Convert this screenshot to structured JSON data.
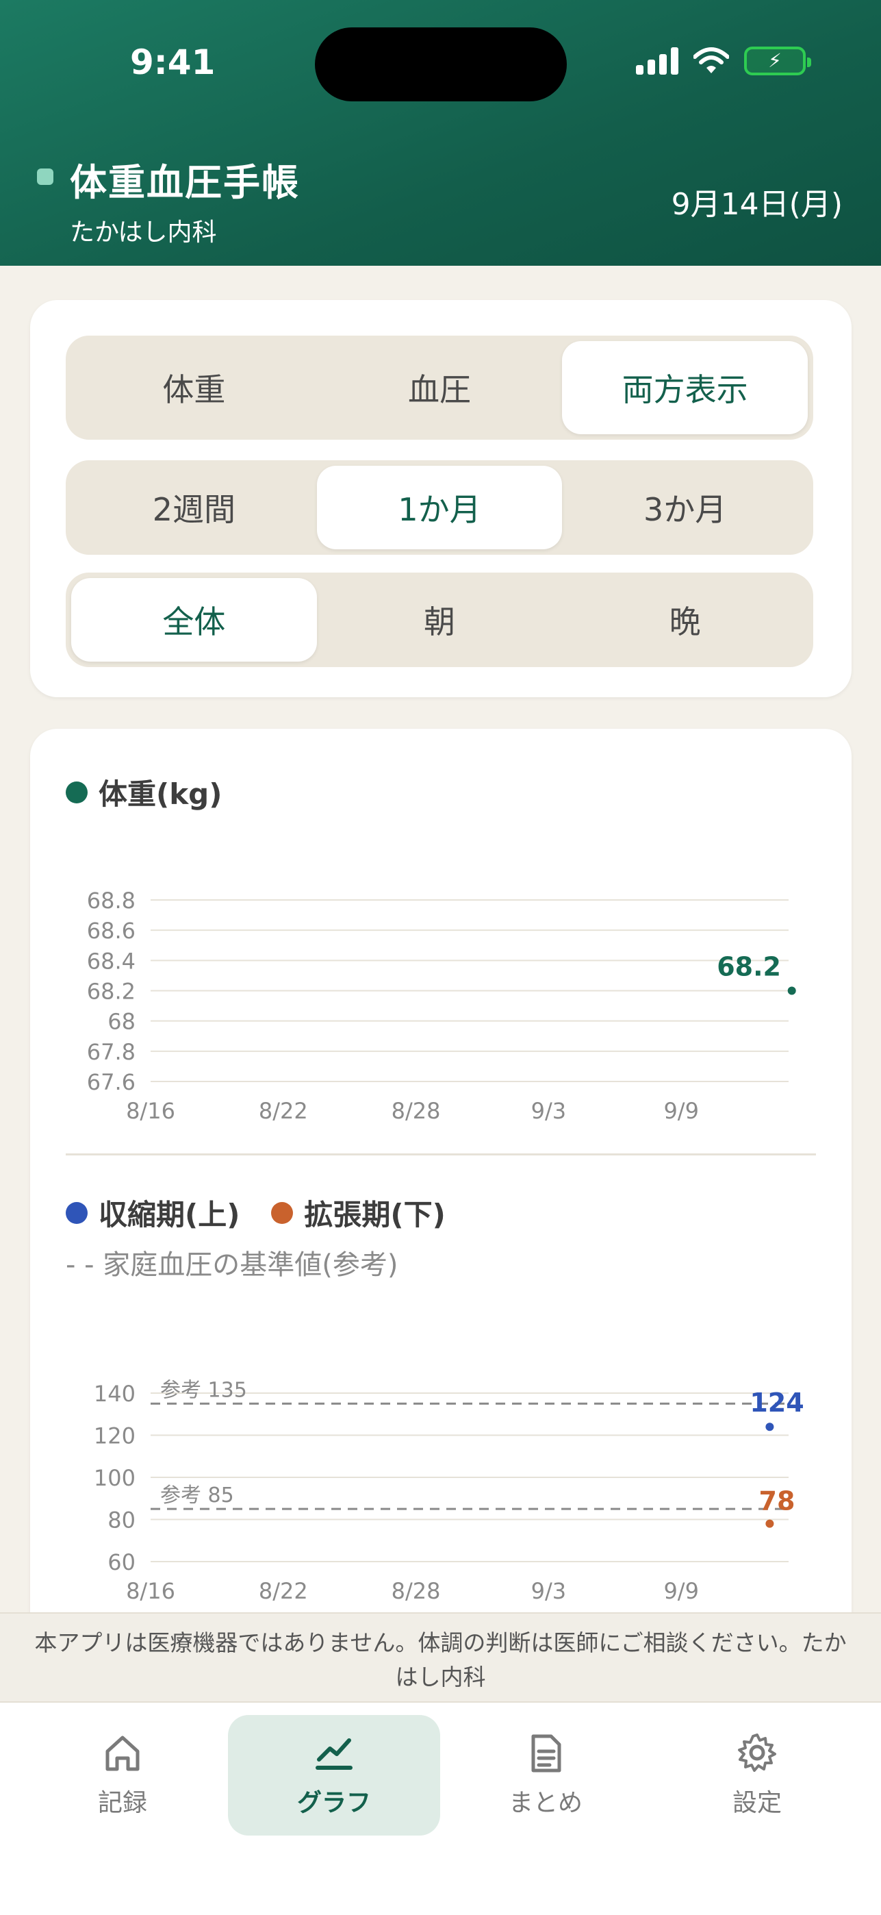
{
  "status_bar": {
    "time": "9:41"
  },
  "header": {
    "title": "体重血圧手帳",
    "subtitle": "たかはし内科",
    "date": "9月14日(月)"
  },
  "controls": {
    "view_options": [
      "体重",
      "血圧",
      "両方表示"
    ],
    "view_selected": "両方表示",
    "range_options": [
      "2週間",
      "1か月",
      "3か月"
    ],
    "range_selected": "1か月",
    "time_options": [
      "全体",
      "朝",
      "晩"
    ],
    "time_selected": "全体"
  },
  "weight_chart": {
    "legend": "体重(kg)",
    "latest_label": "68.2"
  },
  "bp_chart": {
    "legend_systolic": "収縮期(上)",
    "legend_diastolic": "拡張期(下)",
    "reference_note": "- - 家庭血圧の基準値(参考)",
    "ref_upper_label": "参考 135",
    "ref_lower_label": "参考 85",
    "latest_systolic_label": "124",
    "latest_diastolic_label": "78"
  },
  "chart_data": [
    {
      "type": "scatter",
      "title": "",
      "ylabel": "体重(kg)",
      "x_ticks": [
        "8/16",
        "8/22",
        "8/28",
        "9/3",
        "9/9"
      ],
      "y_ticks": [
        "68.8",
        "68.6",
        "68.4",
        "68.2",
        "68",
        "67.8",
        "67.6"
      ],
      "ylim": [
        67.6,
        68.8
      ],
      "series": [
        {
          "name": "体重(kg)",
          "points": [
            {
              "x": "9/14",
              "y": 68.2
            }
          ]
        }
      ]
    },
    {
      "type": "scatter",
      "title": "",
      "x_ticks": [
        "8/16",
        "8/22",
        "8/28",
        "9/3",
        "9/9"
      ],
      "y_ticks": [
        "140",
        "120",
        "100",
        "80",
        "60"
      ],
      "ylim": [
        60,
        140
      ],
      "reference_lines": [
        {
          "label": "参考 135",
          "y": 135
        },
        {
          "label": "参考 85",
          "y": 85
        }
      ],
      "series": [
        {
          "name": "収縮期(上)",
          "points": [
            {
              "x": "9/13",
              "y": 124
            }
          ]
        },
        {
          "name": "拡張期(下)",
          "points": [
            {
              "x": "9/13",
              "y": 78
            }
          ]
        }
      ]
    }
  ],
  "colors": {
    "primary": "#13604c",
    "weight": "#156b54",
    "systolic": "#2f55b8",
    "diastolic": "#c9622d"
  },
  "disclaimer": "本アプリは医療機器ではありません。体調の判断は医師にご相談ください。たかはし内科",
  "tabs": [
    {
      "label": "記録",
      "icon": "home-icon"
    },
    {
      "label": "グラフ",
      "icon": "chart-icon"
    },
    {
      "label": "まとめ",
      "icon": "document-icon"
    },
    {
      "label": "設定",
      "icon": "gear-icon"
    }
  ],
  "active_tab": "グラフ"
}
